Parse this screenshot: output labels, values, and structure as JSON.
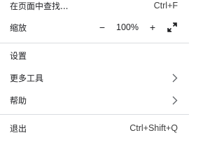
{
  "menu": {
    "find": {
      "label": "在页面中查找...",
      "shortcut": "Ctrl+F"
    },
    "zoom": {
      "label": "缩放",
      "minus_glyph": "−",
      "value": "100%",
      "plus_glyph": "+",
      "fullscreen_icon": "fullscreen-icon"
    },
    "settings": {
      "label": "设置"
    },
    "more_tools": {
      "label": "更多工具",
      "icon": "chevron-right-icon"
    },
    "help": {
      "label": "帮助",
      "icon": "chevron-right-icon"
    },
    "exit": {
      "label": "退出",
      "shortcut": "Ctrl+Shift+Q"
    }
  },
  "colors": {
    "text": "#202124",
    "divider": "#dadce0",
    "background": "#ffffff"
  }
}
